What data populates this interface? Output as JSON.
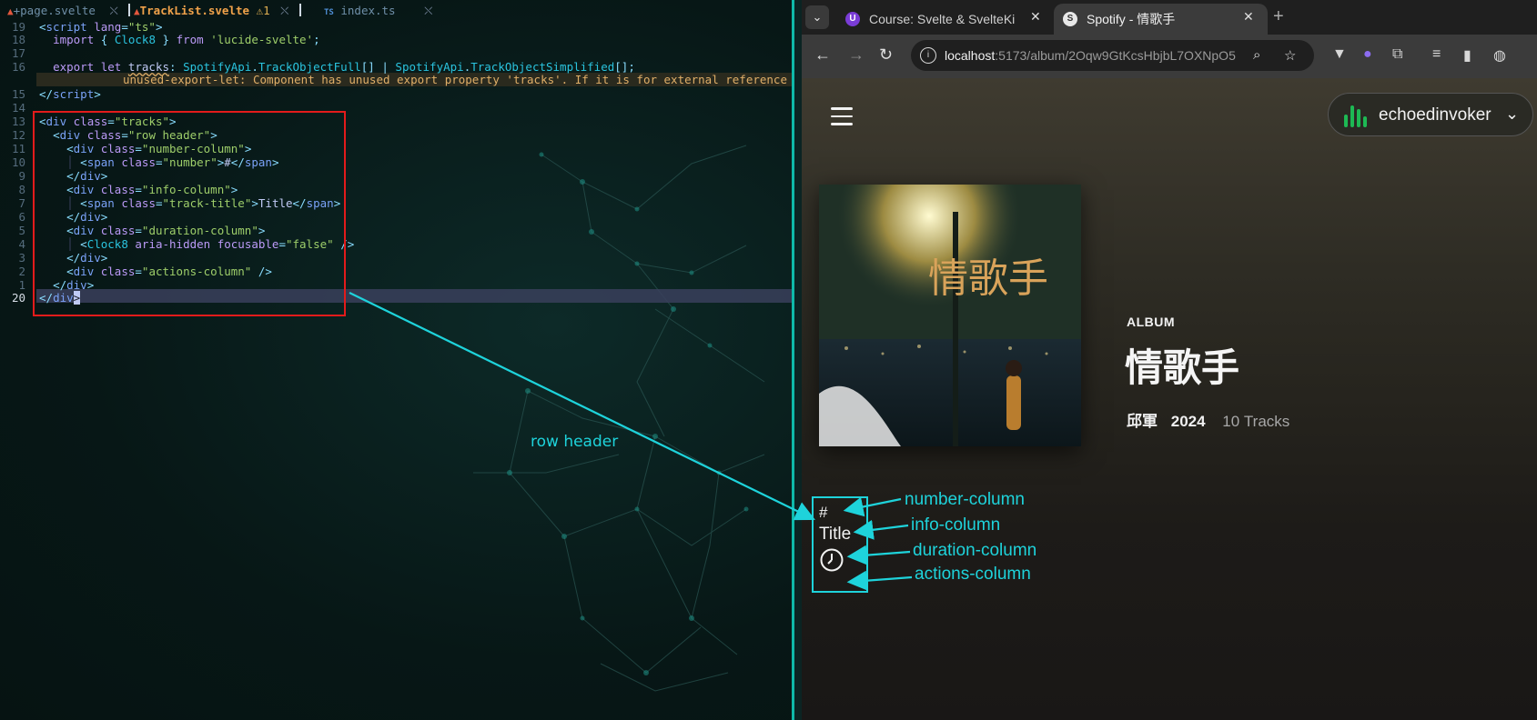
{
  "editor": {
    "tabs": [
      {
        "label": "+page.svelte",
        "close": "⛌"
      },
      {
        "label": "TrackList.svelte",
        "warning": "1",
        "close": "⛌"
      },
      {
        "label": "index.ts",
        "prefix": "TS",
        "close": "⛌"
      }
    ],
    "lines": [
      {
        "num": "19"
      },
      {
        "num": "18"
      },
      {
        "num": "17"
      },
      {
        "num": "16"
      },
      {
        "num": "15"
      },
      {
        "num": "14"
      },
      {
        "num": "13"
      },
      {
        "num": "12"
      },
      {
        "num": "11"
      },
      {
        "num": "10"
      },
      {
        "num": "9"
      },
      {
        "num": "8"
      },
      {
        "num": "7"
      },
      {
        "num": "6"
      },
      {
        "num": "5"
      },
      {
        "num": "4"
      },
      {
        "num": "3"
      },
      {
        "num": "2"
      },
      {
        "num": "1"
      },
      {
        "num": "20"
      }
    ],
    "diagnostic": "unused-export-let: Component has unused export property 'tracks'. If it is for external reference o",
    "annotation_label": "row header"
  },
  "browser": {
    "tabs": [
      {
        "title": "Course: Svelte & SvelteKi",
        "close": "✕"
      },
      {
        "title": "Spotify - 情歌手",
        "close": "✕"
      }
    ],
    "new_tab": "+",
    "url_host": "localhost",
    "url_path": ":5173/album/2Oqw9GtKcsHbjbL7OXNpO5",
    "user": {
      "name": "echoedinvoker"
    },
    "album": {
      "type": "ALBUM",
      "title": "情歌手",
      "artist": "邱軍",
      "year": "2024",
      "tracks": "10 Tracks",
      "cover_text": "情歌手"
    },
    "row_header": {
      "number": "#",
      "title": "Title"
    },
    "annotations": [
      "number-column",
      "info-column",
      "duration-column",
      "actions-column"
    ]
  },
  "colors": {
    "annotation": "#1ed3db",
    "highlight_box": "#e31b1b",
    "spotify_green": "#1db954"
  }
}
